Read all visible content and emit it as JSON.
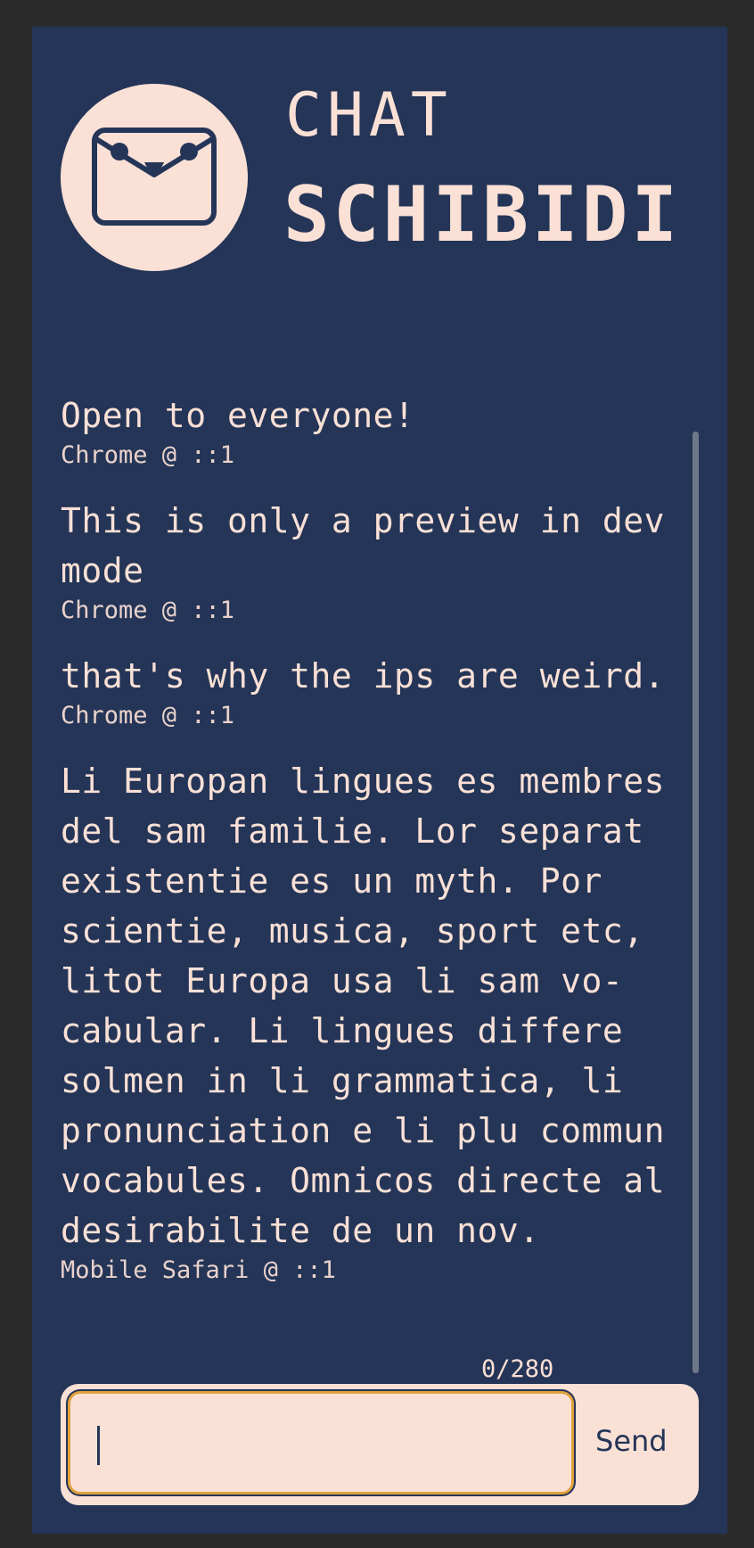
{
  "header": {
    "title_top": "CHAT",
    "title_bottom": "SCHIBIDI",
    "logo_icon": "smiling-envelope-icon"
  },
  "messages": [
    {
      "text": "Open to everyone!",
      "meta": "Chrome @ ::1"
    },
    {
      "text": "This is only a preview in dev mode",
      "meta": "Chrome @ ::1"
    },
    {
      "text": "that's why the ips are weird.",
      "meta": "Chrome @ ::1"
    },
    {
      "text": "Li Europan lingues es membres del sam familie. Lor separat existentie es un myth. Por scientie, musica, sport etc, litot Europa usa li sam vo-cabular. Li lingues differe solmen in li grammatica, li pronunciation e li plu commun vocabules. Omnicos directe al desirabilite de un nov.",
      "meta": "Mobile Safari @ ::1"
    }
  ],
  "composer": {
    "counter": "0/280",
    "input_value": "",
    "send_label": "Send"
  },
  "colors": {
    "background": "#243557",
    "outer": "#2b2b2b",
    "accent": "#fbe0d6",
    "focus": "#e0a13b"
  }
}
